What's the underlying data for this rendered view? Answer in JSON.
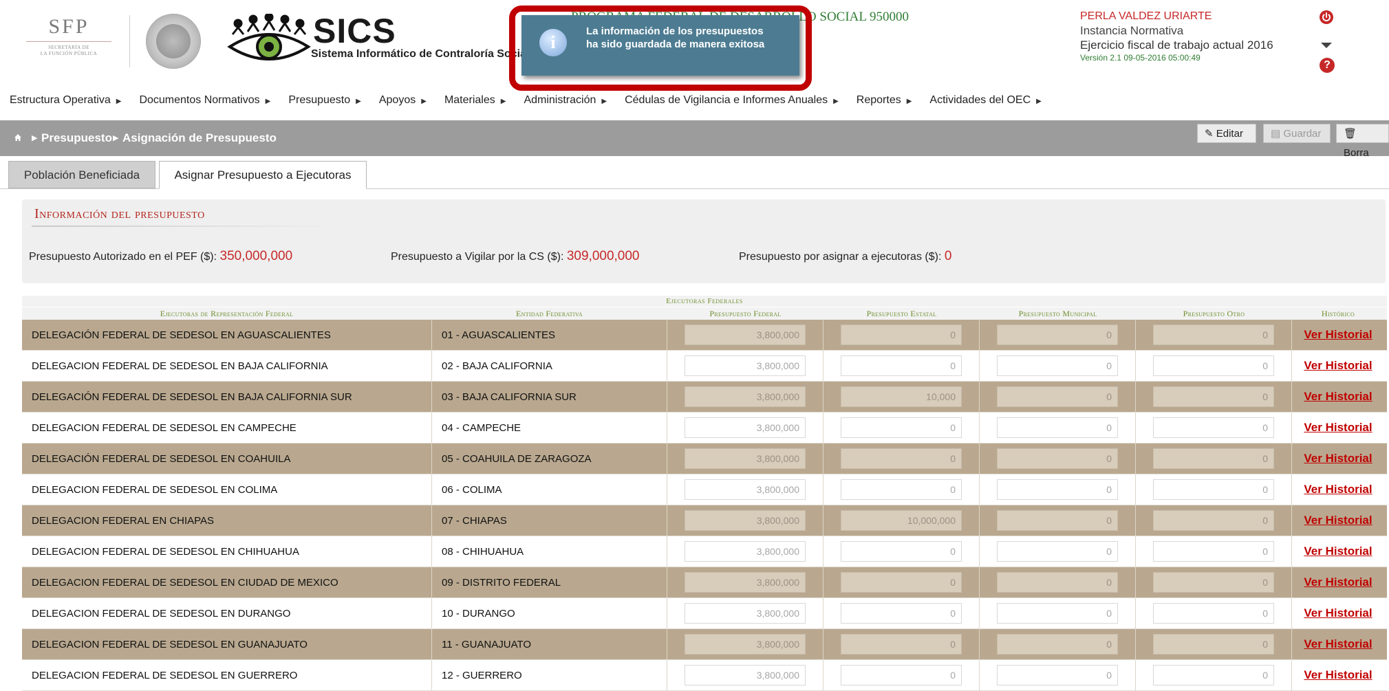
{
  "header": {
    "sfp_title": "SFP",
    "sfp_subtitle_1": "SECRETARÍA DE",
    "sfp_subtitle_2": "LA FUNCIÓN PÚBLICA",
    "app_name": "SICS",
    "app_subtitle": "Sistema Informático de Contraloría Social",
    "program": "PROGRAMA FEDERAL DE DESARROLLO SOCIAL 950000",
    "user_name": "PERLA VALDEZ URIARTE",
    "user_role": "Instancia Normativa",
    "fiscal_year": "Ejercicio fiscal de trabajo actual  2016",
    "version": "Versión 2.1   09-05-2016 05:00:49",
    "icons": [
      "power-icon",
      "caret-down-icon",
      "help-icon"
    ]
  },
  "toast": {
    "line1": "La información de los presupuestos",
    "line2": "ha sido guardada de manera exitosa",
    "icon": "info-icon"
  },
  "menu": [
    "Estructura Operativa",
    "Documentos Normativos",
    "Presupuesto",
    "Apoyos",
    "Materiales",
    "Administración",
    "Cédulas de Vigilancia e Informes Anuales",
    "Reportes",
    "Actividades del OEC"
  ],
  "breadcrumb": {
    "items": [
      "Presupuesto",
      "Asignación de Presupuesto"
    ],
    "home_icon": "home-icon"
  },
  "toolbar": {
    "edit": "Editar",
    "save": "Guardar",
    "delete": "Borra"
  },
  "tabs": [
    {
      "label": "Población Beneficiada",
      "active": false
    },
    {
      "label": "Asignar Presupuesto a Ejecutoras",
      "active": true
    }
  ],
  "info": {
    "title": "Información del presupuesto",
    "authorized_label": "Presupuesto Autorizado en el PEF ($):",
    "authorized_value": "350,000,000",
    "vigilar_label": "Presupuesto a Vigilar por la CS ($):",
    "vigilar_value": "309,000,000",
    "por_asignar_label": "Presupuesto por asignar a ejecutoras ($):",
    "por_asignar_value": "0"
  },
  "table": {
    "group_header": "Ejecutoras Federales",
    "columns": [
      "Ejecutoras de Representación Federal",
      "Entidad Federativa",
      "Presupuesto Federal",
      "Presupuesto Estatal",
      "Presupuesto Municipal",
      "Presupuesto Otro",
      "Histórico"
    ],
    "history_link": "Ver Historial",
    "rows": [
      [
        "DELEGACIÓN FEDERAL DE SEDESOL EN AGUASCALIENTES",
        "01 - AGUASCALIENTES",
        "3,800,000",
        "0",
        "0",
        "0"
      ],
      [
        "DELEGACION FEDERAL DE SEDESOL EN BAJA CALIFORNIA",
        "02 - BAJA CALIFORNIA",
        "3,800,000",
        "0",
        "0",
        "0"
      ],
      [
        "DELEGACIÓN FEDERAL DE SEDESOL EN BAJA CALIFORNIA SUR",
        "03 - BAJA CALIFORNIA SUR",
        "3,800,000",
        "10,000",
        "0",
        "0"
      ],
      [
        "DELEGACION FEDERAL DE SEDESOL EN CAMPECHE",
        "04 - CAMPECHE",
        "3,800,000",
        "0",
        "0",
        "0"
      ],
      [
        "DELEGACIÓN FEDERAL DE SEDESOL EN COAHUILA",
        "05 - COAHUILA DE ZARAGOZA",
        "3,800,000",
        "0",
        "0",
        "0"
      ],
      [
        "DELEGACION FEDERAL DE SEDESOL EN COLIMA",
        "06 - COLIMA",
        "3,800,000",
        "0",
        "0",
        "0"
      ],
      [
        "DELEGACION FEDERAL EN CHIAPAS",
        "07 - CHIAPAS",
        "3,800,000",
        "10,000,000",
        "0",
        "0"
      ],
      [
        "DELEGACION FEDERAL DE SEDESOL EN CHIHUAHUA",
        "08 - CHIHUAHUA",
        "3,800,000",
        "0",
        "0",
        "0"
      ],
      [
        "DELEGACION FEDERAL DE SEDESOL EN CIUDAD DE MEXICO",
        "09 - DISTRITO FEDERAL",
        "3,800,000",
        "0",
        "0",
        "0"
      ],
      [
        "DELEGACION FEDERAL DE SEDESOL EN DURANGO",
        "10 - DURANGO",
        "3,800,000",
        "0",
        "0",
        "0"
      ],
      [
        "DELEGACION FEDERAL DE SEDESOL EN GUANAJUATO",
        "11 - GUANAJUATO",
        "3,800,000",
        "0",
        "0",
        "0"
      ],
      [
        "DELEGACION FEDERAL DE SEDESOL EN GUERRERO",
        "12 - GUERRERO",
        "3,800,000",
        "0",
        "0",
        "0"
      ]
    ]
  }
}
